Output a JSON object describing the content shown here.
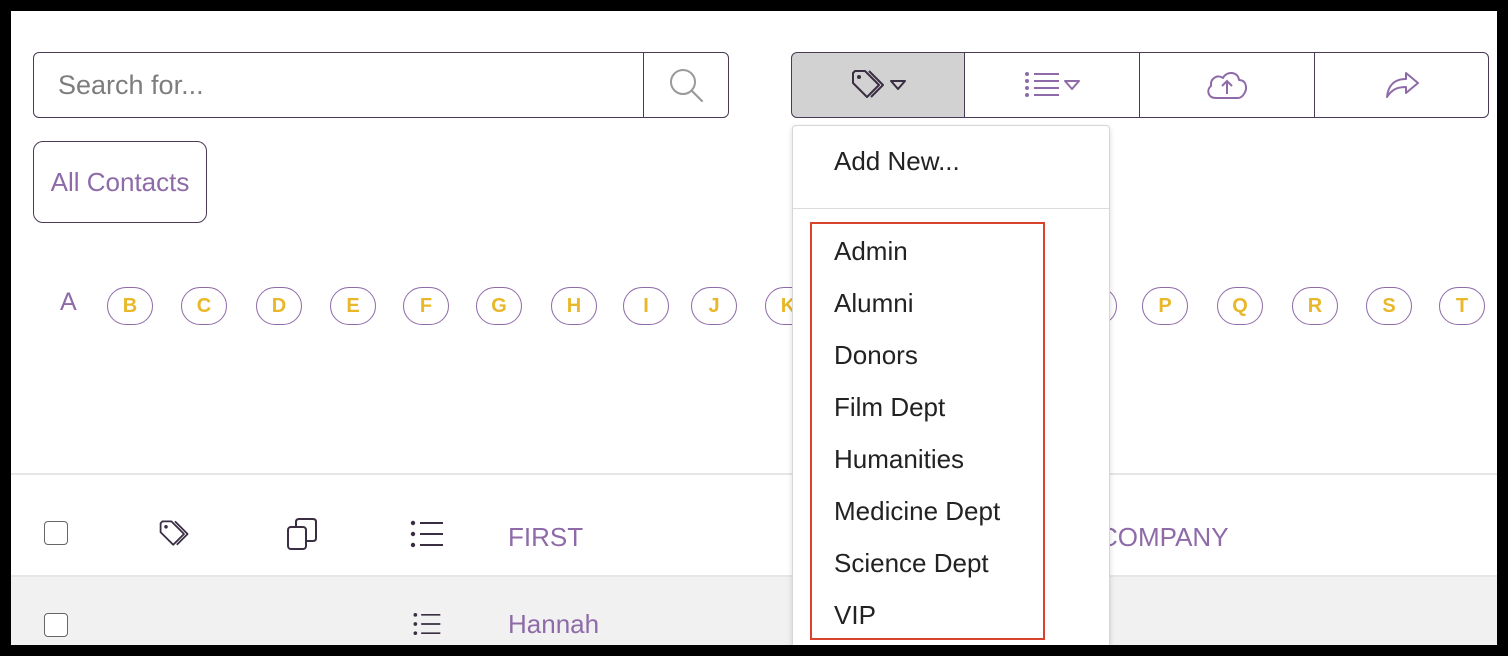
{
  "search": {
    "placeholder": "Search for..."
  },
  "toolbar": {
    "tags_icon": "tag-icon",
    "list_icon": "list-icon",
    "upload_icon": "cloud-upload-icon",
    "share_icon": "share-icon"
  },
  "all_contacts_label": "All Contacts",
  "alphabet": {
    "active": "A",
    "letters": [
      "B",
      "C",
      "D",
      "E",
      "F",
      "G",
      "H",
      "I",
      "J",
      "K",
      "P",
      "Q",
      "R",
      "S",
      "T"
    ]
  },
  "table": {
    "columns": {
      "first": "FIRST",
      "company": "COMPANY"
    },
    "rows": [
      {
        "first": "Hannah"
      }
    ]
  },
  "tag_menu": {
    "add_new": "Add New...",
    "tags": [
      "Admin",
      "Alumni",
      "Donors",
      "Film Dept",
      "Humanities",
      "Medicine Dept",
      "Science Dept",
      "VIP"
    ]
  },
  "colors": {
    "accent": "#8e6ba8",
    "letter": "#e8b82a",
    "highlight": "#d9432e",
    "border": "#4a3a55"
  }
}
